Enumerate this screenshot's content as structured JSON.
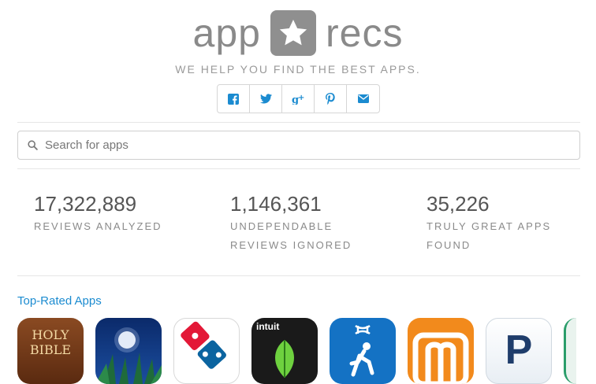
{
  "logo": {
    "left": "app",
    "right": "recs",
    "icon": "star-icon"
  },
  "tagline": "WE HELP YOU FIND THE BEST APPS.",
  "share": [
    {
      "name": "facebook-icon",
      "glyph": "f"
    },
    {
      "name": "twitter-icon",
      "glyph": "t"
    },
    {
      "name": "google-plus-icon",
      "glyph": "g+"
    },
    {
      "name": "pinterest-icon",
      "glyph": "p"
    },
    {
      "name": "email-icon",
      "glyph": "mail"
    }
  ],
  "search": {
    "placeholder": "Search for apps",
    "value": ""
  },
  "stats": [
    {
      "number": "17,322,889",
      "label_line1": "REVIEWS ANALYZED",
      "label_line2": ""
    },
    {
      "number": "1,146,361",
      "label_line1": "UNDEPENDABLE",
      "label_line2": "REVIEWS IGNORED"
    },
    {
      "number": "35,226",
      "label_line1": "TRULY GREAT APPS",
      "label_line2": "FOUND"
    }
  ],
  "top_rated": {
    "title": "Top-Rated Apps",
    "apps": [
      {
        "icon": "holy-bible-app-icon",
        "text_line1": "HOLY",
        "text_line2": "BIBLE"
      },
      {
        "icon": "night-moon-app-icon"
      },
      {
        "icon": "dominos-app-icon"
      },
      {
        "icon": "intuit-mint-app-icon",
        "text": "intuit"
      },
      {
        "icon": "under-armour-app-icon"
      },
      {
        "icon": "orange-m-app-icon"
      },
      {
        "icon": "pandora-app-icon",
        "text": "P"
      }
    ]
  },
  "colors": {
    "accent": "#1b8bd0",
    "logo_gray": "#8a8a8a"
  }
}
